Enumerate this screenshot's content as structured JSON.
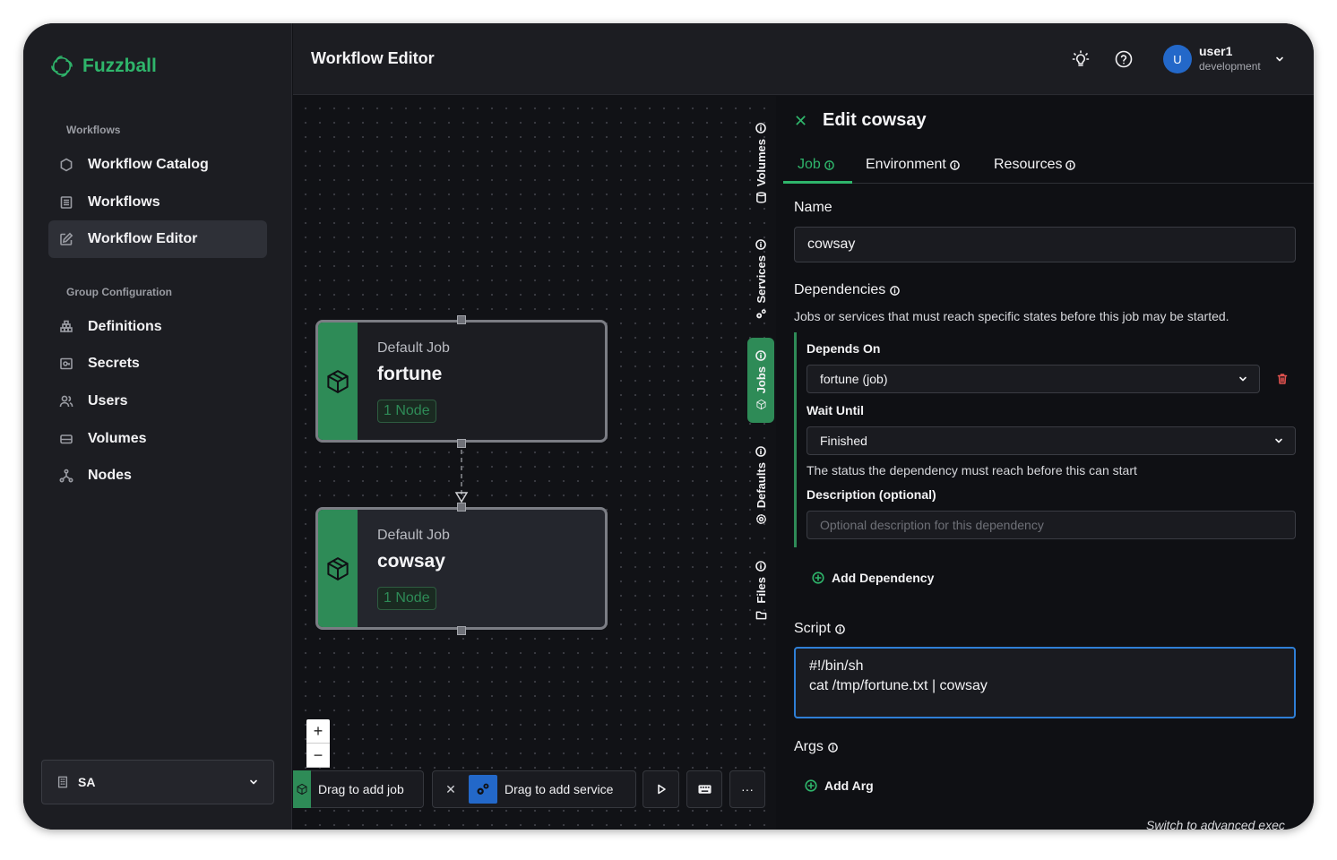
{
  "app": {
    "name": "Fuzzball"
  },
  "sidebar": {
    "workflows_label": "Workflows",
    "items": [
      {
        "label": "Workflow Catalog",
        "icon": "hexagon-icon"
      },
      {
        "label": "Workflows",
        "icon": "list-icon"
      },
      {
        "label": "Workflow Editor",
        "icon": "edit-icon",
        "active": true
      }
    ],
    "group_label": "Group Configuration",
    "group_items": [
      {
        "label": "Definitions",
        "icon": "boxes-icon"
      },
      {
        "label": "Secrets",
        "icon": "secret-icon"
      },
      {
        "label": "Users",
        "icon": "users-icon"
      },
      {
        "label": "Volumes",
        "icon": "drive-icon"
      },
      {
        "label": "Nodes",
        "icon": "network-icon"
      }
    ],
    "org": "SA"
  },
  "header": {
    "title": "Workflow Editor",
    "user": "user1",
    "env": "development",
    "avatar": "U"
  },
  "canvas": {
    "nodes": [
      {
        "type": "Default Job",
        "name": "fortune",
        "badge": "1 Node"
      },
      {
        "type": "Default Job",
        "name": "cowsay",
        "badge": "1 Node"
      }
    ],
    "side_tabs": [
      "Volumes",
      "Services",
      "Jobs",
      "Defaults",
      "Files"
    ],
    "zoom_in": "+",
    "zoom_out": "−",
    "toolbar": {
      "add_job": "Drag to add job",
      "close": "✕",
      "add_service": "Drag to add service",
      "more": "···"
    }
  },
  "panel": {
    "title": "Edit cowsay",
    "tabs": [
      "Job",
      "Environment",
      "Resources"
    ],
    "name_label": "Name",
    "name_value": "cowsay",
    "deps_label": "Dependencies",
    "deps_help": "Jobs or services that must reach specific states before this job may be started.",
    "depends_on_label": "Depends On",
    "depends_on_value": "fortune (job)",
    "wait_until_label": "Wait Until",
    "wait_until_value": "Finished",
    "wait_help": "The status the dependency must reach before this can start",
    "desc_label": "Description (optional)",
    "desc_placeholder": "Optional description for this dependency",
    "add_dependency": "Add Dependency",
    "script_label": "Script",
    "script_line1": "#!/bin/sh",
    "script_line2": "cat /tmp/fortune.txt | cowsay",
    "args_label": "Args",
    "add_arg": "Add Arg",
    "advanced": "Switch to advanced exec"
  },
  "colors": {
    "accent": "#2fb56b",
    "node_strip": "#2e8b57",
    "focus": "#2f7fd6",
    "danger": "#e0524f"
  }
}
